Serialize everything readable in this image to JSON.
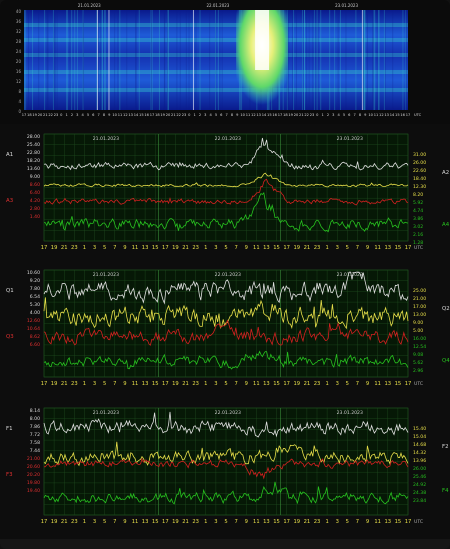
{
  "spectrogram": {
    "top_dates": [
      "21.01.2023",
      "22.01.2023",
      "23.01.2023"
    ],
    "y_ticks": [
      "40",
      "36",
      "32",
      "28",
      "24",
      "20",
      "16",
      "12",
      "8",
      "4",
      "0"
    ],
    "hours": [
      "17",
      "18",
      "19",
      "20",
      "21",
      "22",
      "23",
      "0",
      "1",
      "2",
      "3",
      "4",
      "5",
      "6",
      "7",
      "8",
      "9",
      "10",
      "11",
      "12",
      "13",
      "14",
      "15",
      "16",
      "17",
      "18",
      "19",
      "20",
      "21",
      "22",
      "23",
      "0",
      "1",
      "2",
      "3",
      "4",
      "5",
      "6",
      "7",
      "8",
      "9",
      "10",
      "11",
      "12",
      "13",
      "14",
      "15",
      "16",
      "17",
      "18",
      "19",
      "20",
      "21",
      "22",
      "23",
      "0",
      "1",
      "2",
      "3",
      "4",
      "5",
      "6",
      "7",
      "8",
      "9",
      "10",
      "11",
      "12",
      "13",
      "14",
      "15",
      "16",
      "17"
    ],
    "hour_unit": "UTC",
    "colors": {
      "low": "#0a1a8c",
      "mid": "#1e5bd8",
      "cyan": "#3ad9d0",
      "high": "#e8f07a",
      "peak": "#ffffff"
    }
  },
  "chart_data": [
    {
      "type": "line",
      "panel": "amplitude",
      "dates": [
        "21.01.2023",
        "22.01.2023",
        "23.01.2023"
      ],
      "x_tick_labels": [
        "17",
        "19",
        "21",
        "23",
        "1",
        "3",
        "5",
        "7",
        "9",
        "11",
        "13",
        "15",
        "17",
        "19",
        "21",
        "23",
        "1",
        "3",
        "5",
        "7",
        "9",
        "11",
        "13",
        "15",
        "17",
        "19",
        "21",
        "23",
        "1",
        "3",
        "5",
        "7",
        "9",
        "11",
        "13",
        "15",
        "17"
      ],
      "x_unit": "UTC",
      "left_labels": [
        "A1",
        "A3"
      ],
      "right_labels": [
        "A2",
        "A4"
      ],
      "left_ticks_white": [
        "28.00",
        "25.40",
        "22.80",
        "18.20",
        "13.60",
        "9.00"
      ],
      "left_ticks_red": [
        "8.60",
        "6.40",
        "4.20",
        "2.80",
        "1.40"
      ],
      "right_ticks_yellow": [
        "31.00",
        "26.00",
        "22.60",
        "18.40",
        "12.30",
        "8.20"
      ],
      "right_ticks_green": [
        "5.92",
        "4.74",
        "3.86",
        "3.02",
        "2.16",
        "1.28"
      ],
      "series": [
        {
          "color": "#e0e0e0",
          "base": 0.3,
          "amp": 0.025,
          "spike_at": 0.61,
          "spike": 0.24
        },
        {
          "color": "#e8e04a",
          "base": 0.48,
          "amp": 0.01,
          "spike_at": 0.61,
          "spike": 0.12
        },
        {
          "color": "#d42020",
          "base": 0.63,
          "amp": 0.02,
          "spike_at": 0.61,
          "spike": 0.2
        },
        {
          "color": "#27c21f",
          "base": 0.84,
          "amp": 0.04,
          "spike_at": 0.6,
          "spike": 0.28
        }
      ]
    },
    {
      "type": "line",
      "panel": "q-factor",
      "dates": [
        "21.01.2023",
        "22.01.2023",
        "23.01.2023"
      ],
      "x_tick_labels": [
        "17",
        "19",
        "21",
        "23",
        "1",
        "3",
        "5",
        "7",
        "9",
        "11",
        "13",
        "15",
        "17",
        "19",
        "21",
        "23",
        "1",
        "3",
        "5",
        "7",
        "9",
        "11",
        "13",
        "15",
        "17",
        "19",
        "21",
        "23",
        "1",
        "3",
        "5",
        "7",
        "9",
        "11",
        "13",
        "15",
        "17"
      ],
      "x_unit": "UTC",
      "left_labels": [
        "Q1",
        "Q3"
      ],
      "right_labels": [
        "Q2",
        "Q4"
      ],
      "left_ticks_white": [
        "10.60",
        "9.20",
        "7.80",
        "6.54",
        "5.30",
        "4.00"
      ],
      "left_ticks_red": [
        "12.60",
        "10.64",
        "8.62",
        "6.60"
      ],
      "right_ticks_yellow": [
        "25.00",
        "21.00",
        "17.00",
        "13.00",
        "9.00",
        "5.00"
      ],
      "right_ticks_green": [
        "16.00",
        "12.54",
        "9.08",
        "5.62",
        "2.96"
      ],
      "series": [
        {
          "color": "#e0e0e0",
          "base": 0.2,
          "amp": 0.07,
          "spike_at": 0.86,
          "spike": 0.2
        },
        {
          "color": "#e8e04a",
          "base": 0.44,
          "amp": 0.07,
          "spike_at": 0.62,
          "spike": 0.12
        },
        {
          "color": "#d42020",
          "base": 0.62,
          "amp": 0.05,
          "spike_at": 0.5,
          "spike": 0.1
        },
        {
          "color": "#27c21f",
          "base": 0.86,
          "amp": 0.04,
          "spike_at": 0.6,
          "spike": 0.1
        }
      ]
    },
    {
      "type": "line",
      "panel": "frequency",
      "dates": [
        "21.01.2023",
        "22.01.2023",
        "23.01.2023"
      ],
      "x_tick_labels": [
        "17",
        "19",
        "21",
        "23",
        "1",
        "3",
        "5",
        "7",
        "9",
        "11",
        "13",
        "15",
        "17",
        "19",
        "21",
        "23",
        "1",
        "3",
        "5",
        "7",
        "9",
        "11",
        "13",
        "15",
        "17",
        "19",
        "21",
        "23",
        "1",
        "3",
        "5",
        "7",
        "9",
        "11",
        "13",
        "15",
        "17"
      ],
      "x_unit": "UTC",
      "left_labels": [
        "F1",
        "F3"
      ],
      "right_labels": [
        "F2",
        "F4"
      ],
      "left_ticks_white": [
        "8.14",
        "8.00",
        "7.86",
        "7.72",
        "7.58",
        "7.44"
      ],
      "left_ticks_red": [
        "21.00",
        "20.60",
        "20.20",
        "19.80",
        "19.40"
      ],
      "right_ticks_yellow": [
        "15.40",
        "15.04",
        "14.68",
        "14.32",
        "13.96"
      ],
      "right_ticks_green": [
        "26.00",
        "25.46",
        "24.92",
        "24.38",
        "23.84"
      ],
      "series": [
        {
          "color": "#e0e0e0",
          "base": 0.18,
          "amp": 0.05,
          "spike_at": 0.62,
          "spike": -0.1
        },
        {
          "color": "#e8e04a",
          "base": 0.46,
          "amp": 0.05,
          "spike_at": 0.66,
          "spike": 0.1
        },
        {
          "color": "#d42020",
          "base": 0.52,
          "amp": 0.03,
          "spike_at": 0.6,
          "spike": -0.14
        },
        {
          "color": "#27c21f",
          "base": 0.84,
          "amp": 0.04,
          "spike_at": 0.62,
          "spike": 0.1
        }
      ]
    }
  ]
}
